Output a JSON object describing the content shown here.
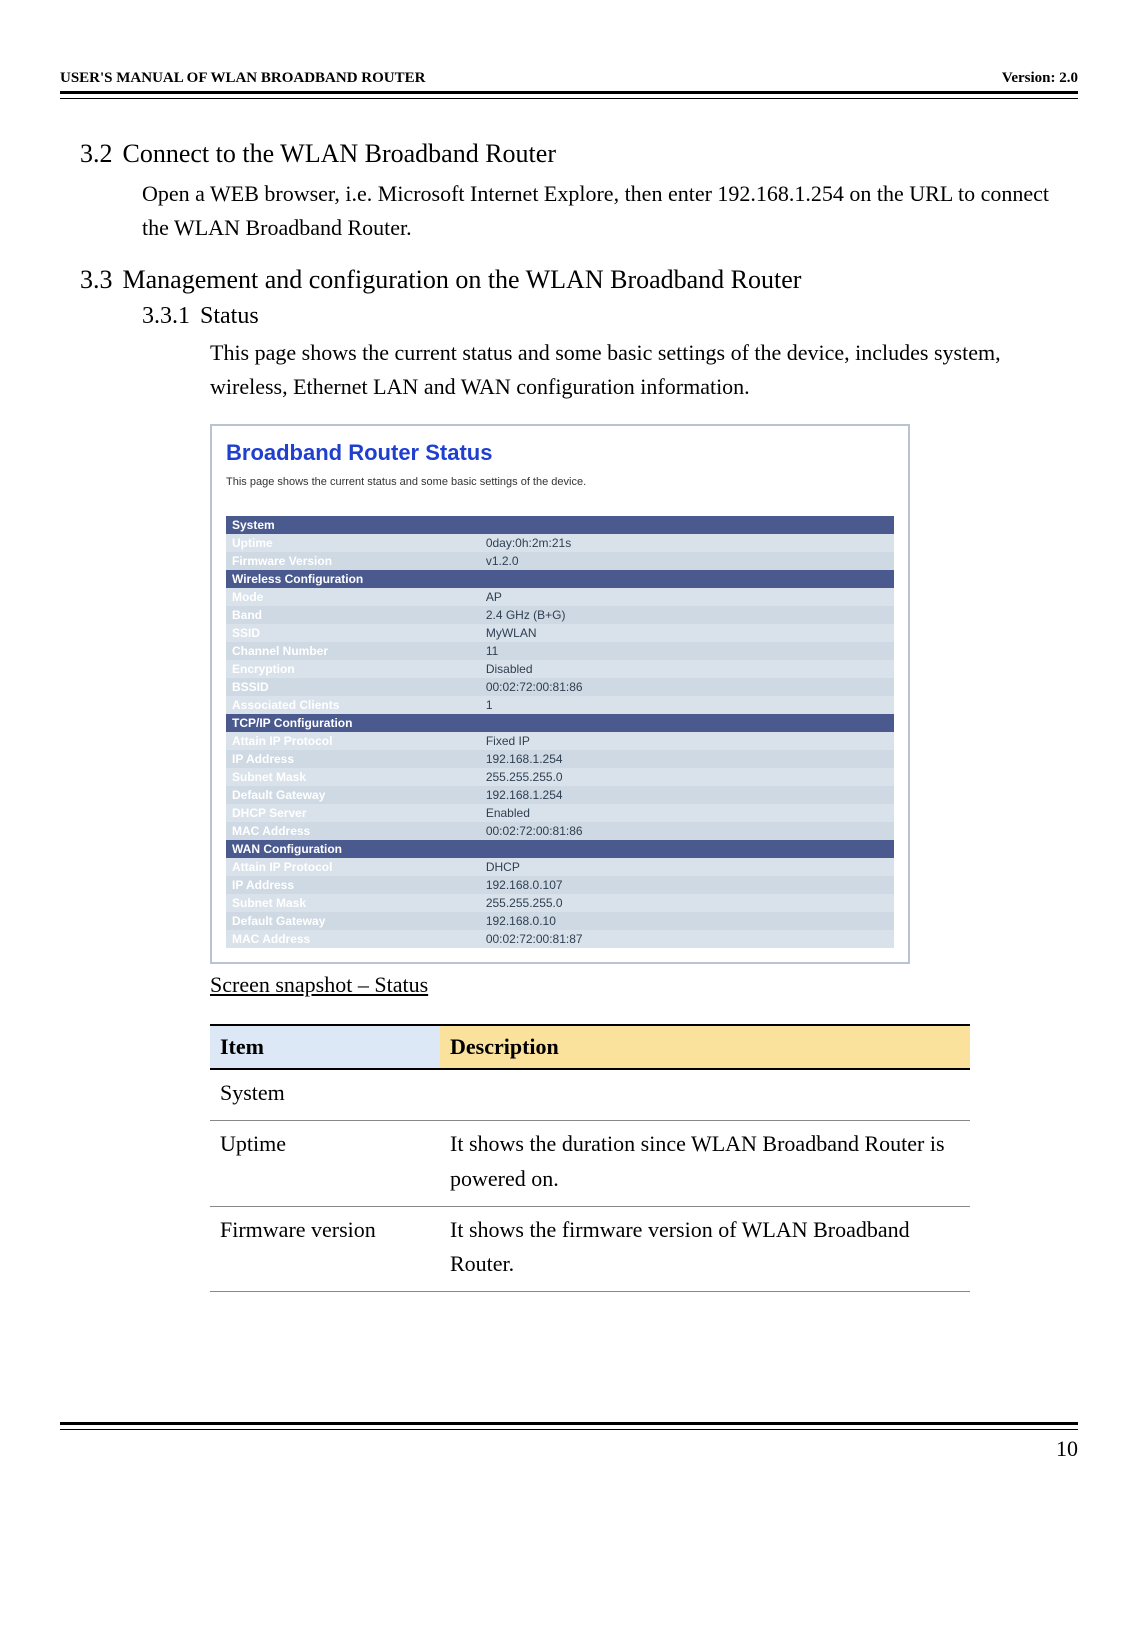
{
  "header": {
    "title": "USER'S MANUAL OF WLAN BROADBAND ROUTER",
    "version": "Version: 2.0"
  },
  "sections": {
    "s32": {
      "num": "3.2",
      "title": "Connect to the WLAN Broadband Router",
      "body": "Open a WEB browser, i.e. Microsoft Internet Explore, then enter 192.168.1.254 on the URL to connect the WLAN Broadband Router."
    },
    "s33": {
      "num": "3.3",
      "title": "Management and configuration on the WLAN Broadband Router"
    },
    "s331": {
      "num": "3.3.1",
      "title": "Status",
      "body": "This page shows the current status and some basic settings of the device, includes system, wireless, Ethernet LAN and WAN configuration information."
    }
  },
  "screenshot": {
    "title": "Broadband Router Status",
    "desc": "This page shows the current status and some basic settings of the device.",
    "groups": [
      {
        "name": "System",
        "rows": [
          {
            "label": "Uptime",
            "value": "0day:0h:2m:21s"
          },
          {
            "label": "Firmware Version",
            "value": "v1.2.0"
          }
        ]
      },
      {
        "name": "Wireless Configuration",
        "rows": [
          {
            "label": "Mode",
            "value": "AP"
          },
          {
            "label": "Band",
            "value": "2.4 GHz (B+G)"
          },
          {
            "label": "SSID",
            "value": "MyWLAN"
          },
          {
            "label": "Channel Number",
            "value": "11"
          },
          {
            "label": "Encryption",
            "value": "Disabled"
          },
          {
            "label": "BSSID",
            "value": "00:02:72:00:81:86"
          },
          {
            "label": "Associated Clients",
            "value": "1"
          }
        ]
      },
      {
        "name": "TCP/IP Configuration",
        "rows": [
          {
            "label": "Attain IP Protocol",
            "value": "Fixed IP"
          },
          {
            "label": "IP Address",
            "value": "192.168.1.254"
          },
          {
            "label": "Subnet Mask",
            "value": "255.255.255.0"
          },
          {
            "label": "Default Gateway",
            "value": "192.168.1.254"
          },
          {
            "label": "DHCP Server",
            "value": "Enabled"
          },
          {
            "label": "MAC Address",
            "value": "00:02:72:00:81:86"
          }
        ]
      },
      {
        "name": "WAN Configuration",
        "rows": [
          {
            "label": "Attain IP Protocol",
            "value": "DHCP"
          },
          {
            "label": "IP Address",
            "value": "192.168.0.107"
          },
          {
            "label": "Subnet Mask",
            "value": "255.255.255.0"
          },
          {
            "label": "Default Gateway",
            "value": "192.168.0.10"
          },
          {
            "label": "MAC Address",
            "value": "00:02:72:00:81:87"
          }
        ]
      }
    ],
    "caption": "Screen snapshot – Status"
  },
  "desc_table": {
    "headers": {
      "item": "Item",
      "desc": "Description"
    },
    "rows": [
      {
        "item": "System",
        "desc": ""
      },
      {
        "item": "Uptime",
        "desc": "It shows the duration since WLAN Broadband Router is powered on."
      },
      {
        "item": "Firmware version",
        "desc": "It shows the firmware version of WLAN Broadband Router."
      }
    ]
  },
  "page_number": "10"
}
